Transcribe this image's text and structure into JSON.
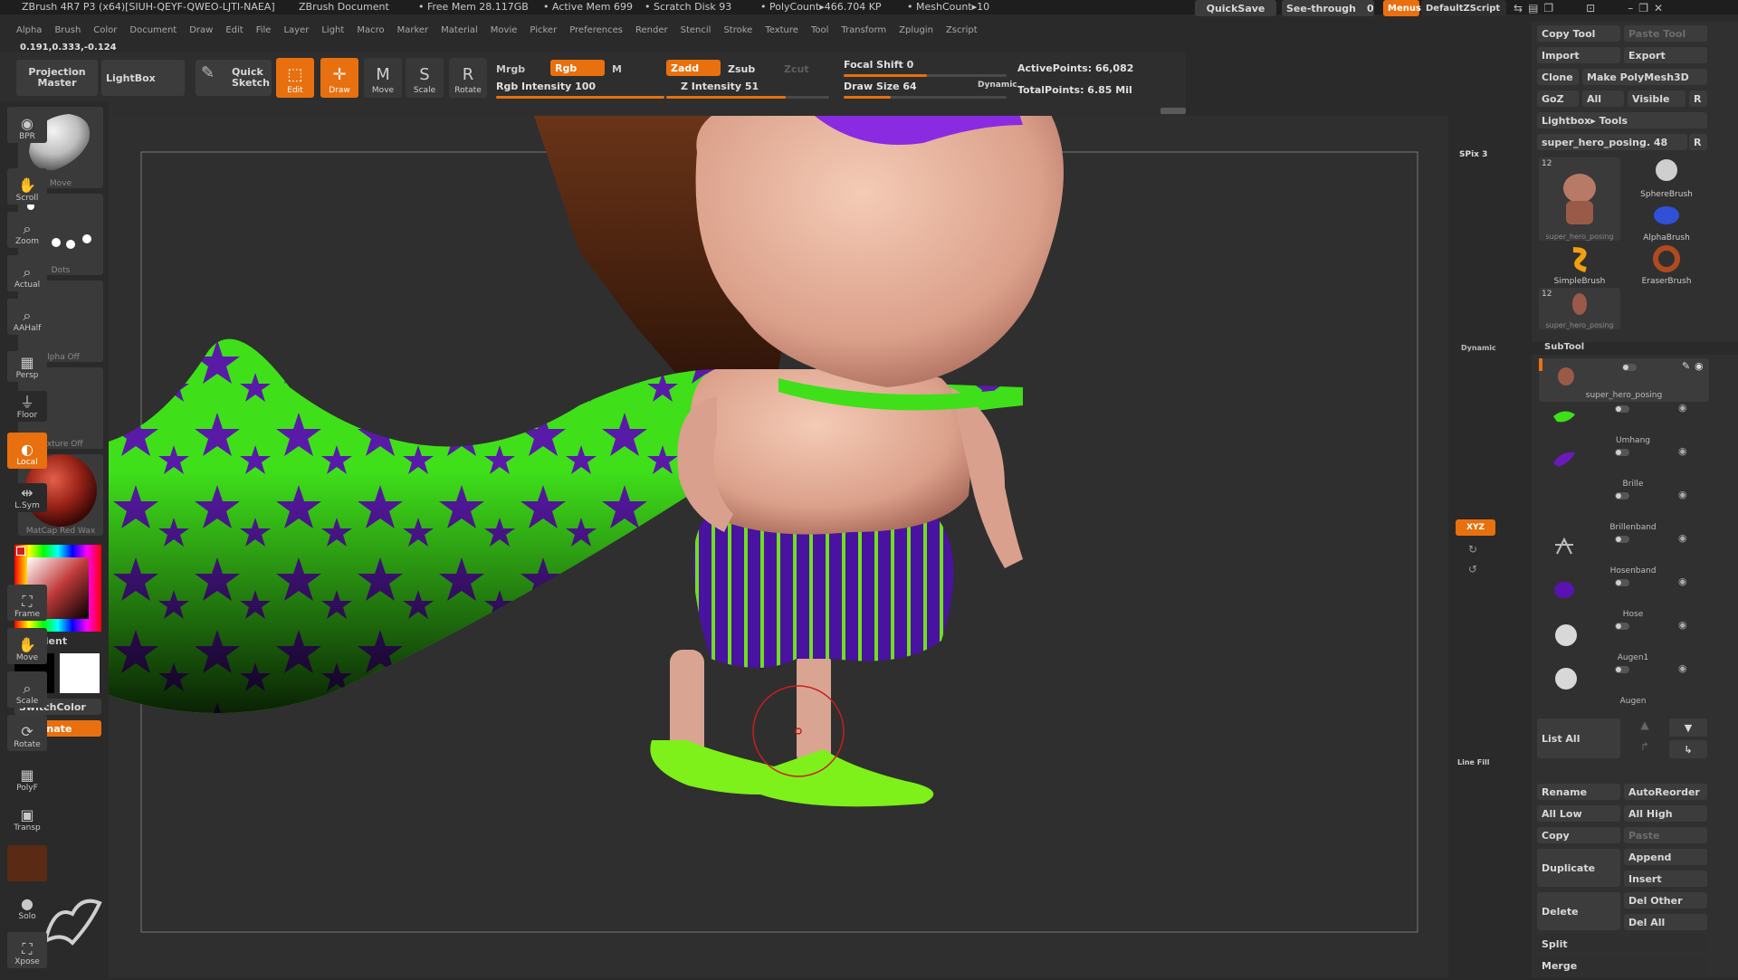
{
  "title_bar": {
    "app": "ZBrush 4R7 P3 (x64)[SIUH-QEYF-QWEO-LJTI-NAEA]",
    "document": "ZBrush Document",
    "free_mem": "• Free Mem 28.117GB",
    "active_mem": "• Active Mem 699",
    "scratch_disk": "• Scratch Disk 93",
    "poly_count": "• PolyCount▸466.704 KP",
    "mesh_count": "• MeshCount▸10",
    "quicksave": "QuickSave",
    "see_through": "See-through",
    "see_through_value": "0",
    "menus": "Menus",
    "default_zscript": "DefaultZScript"
  },
  "menubar": [
    "Alpha",
    "Brush",
    "Color",
    "Document",
    "Draw",
    "Edit",
    "File",
    "Layer",
    "Light",
    "Macro",
    "Marker",
    "Material",
    "Movie",
    "Picker",
    "Preferences",
    "Render",
    "Stencil",
    "Stroke",
    "Texture",
    "Tool",
    "Transform",
    "Zplugin",
    "Zscript"
  ],
  "coords": "0.191,0.333,-0.124",
  "toolbar": {
    "projection_master": "Projection Master",
    "lightbox": "LightBox",
    "quick_sketch": "Quick Sketch",
    "edit": "Edit",
    "draw": "Draw",
    "move": "Move",
    "scale": "Scale",
    "rotate": "Rotate",
    "mrgb": "Mrgb",
    "rgb": "Rgb",
    "m": "M",
    "rgb_intensity": "Rgb Intensity 100",
    "zadd": "Zadd",
    "zsub": "Zsub",
    "zcut": "Zcut",
    "z_intensity": "Z Intensity 51",
    "focal_shift": "Focal Shift 0",
    "draw_size": "Draw Size 64",
    "dynamic": "Dynamic",
    "active_points": "ActivePoints: 66,082",
    "total_points": "TotalPoints: 6.85 Mil"
  },
  "left_panel": {
    "brush_label": "Move",
    "stroke_label": "Dots",
    "alpha_label": "Alpha Off",
    "texture_label": "Texture Off",
    "material_label": "MatCap Red Wax",
    "gradient": "Gradient",
    "switch_color": "SwitchColor",
    "alternate": "Alternate"
  },
  "right_bar": [
    {
      "label": "BPR",
      "icon": "bpr-icon"
    },
    {
      "label": "Scroll",
      "icon": "hand-icon"
    },
    {
      "label": "Zoom",
      "icon": "zoom-icon"
    },
    {
      "label": "Actual",
      "icon": "actual-icon"
    },
    {
      "label": "AAHalf",
      "icon": "aahalf-icon"
    },
    {
      "label": "Persp",
      "icon": "persp-icon"
    },
    {
      "label": "Floor",
      "icon": "floor-icon"
    },
    {
      "label": "Local",
      "icon": "local-icon"
    },
    {
      "label": "L.Sym",
      "icon": "lsym-icon"
    },
    {
      "label": "Frame",
      "icon": "frame-icon"
    },
    {
      "label": "Move",
      "icon": "move-icon"
    },
    {
      "label": "Scale",
      "icon": "scale-icon"
    },
    {
      "label": "Rotate",
      "icon": "rotate-icon"
    },
    {
      "label": "PolyF",
      "icon": "polyf-icon"
    },
    {
      "label": "Transp",
      "icon": "transp-icon"
    },
    {
      "label": "Solo",
      "icon": "solo-icon"
    },
    {
      "label": "Xpose",
      "icon": "xpose-icon"
    }
  ],
  "right_bar_extra": {
    "spix": "SPix 3",
    "dynamic": "Dynamic",
    "xyz": "XYZ",
    "line_fill": "Line Fill"
  },
  "tool_panel": {
    "copy_tool": "Copy Tool",
    "paste_tool": "Paste Tool",
    "import": "Import",
    "export": "Export",
    "clone": "Clone",
    "make_polymesh": "Make PolyMesh3D",
    "goz": "GoZ",
    "all": "All",
    "visible": "Visible",
    "r": "R",
    "lightbox_tools": "Lightbox▸ Tools",
    "current_tool": "super_hero_posing. 48",
    "tools": [
      {
        "name": "super_hero_posing",
        "count": "12"
      },
      {
        "name": "SphereBrush"
      },
      {
        "name": "AlphaBrush"
      },
      {
        "name": "SimpleBrush"
      },
      {
        "name": "EraserBrush"
      },
      {
        "name": "super_hero_posing",
        "count": "12"
      }
    ]
  },
  "subtool": {
    "header": "SubTool",
    "items": [
      "super_hero_posing",
      "Umhang",
      "Brille",
      "Brillenband",
      "Hosenband",
      "Hose",
      "Augen1",
      "Augen"
    ],
    "list_all": "List All",
    "rename": "Rename",
    "auto_reorder": "AutoReorder",
    "all_low": "All Low",
    "all_high": "All High",
    "copy": "Copy",
    "paste": "Paste",
    "duplicate": "Duplicate",
    "append": "Append",
    "insert": "Insert",
    "delete": "Delete",
    "del_other": "Del Other",
    "del_all": "Del All",
    "split": "Split",
    "merge": "Merge"
  },
  "colors": {
    "accent": "#e8700f",
    "cape_green": "#3fe01a",
    "cape_stars": "#5a1aa8",
    "skin": "#e8b49e"
  }
}
